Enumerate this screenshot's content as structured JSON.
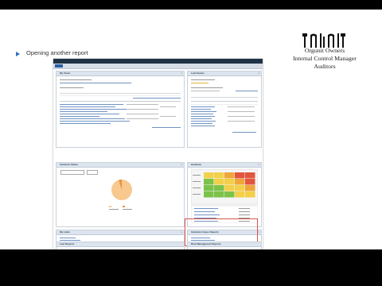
{
  "slide": {
    "bullet_text": "Opening another report",
    "roles": [
      "Orgunit Owners",
      "Internal Control Manager",
      "Auditors"
    ],
    "accent": "#2f6fc2"
  },
  "screenshot": {
    "panels": {
      "my_tasks": "My Tasks",
      "last_events": "Last Events",
      "incidents_status": "Incidents Status",
      "heatmap": "Heatmap",
      "my_links": "My Links",
      "incidents_cases_reports": "Incidents Cases Reports",
      "last_reports": "Last Reports",
      "risk_management_reports": "Risk Management Reports"
    },
    "highlight_color": "#d9534f"
  },
  "chart_data": {
    "type": "pie",
    "title": "",
    "values": [
      95,
      5
    ],
    "colors": [
      "#f7c98f",
      "#e9923c"
    ]
  }
}
